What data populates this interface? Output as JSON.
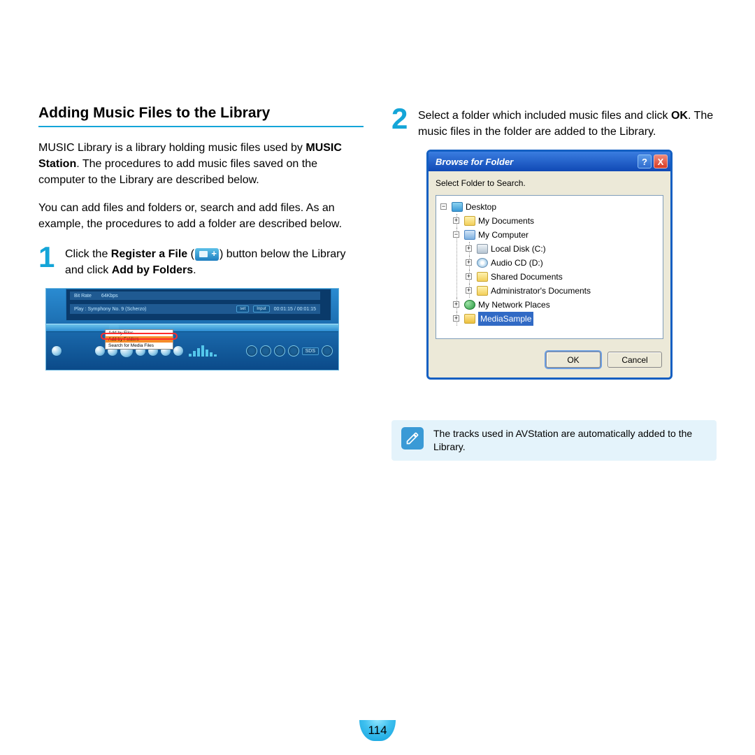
{
  "heading": "Adding Music Files to the Library",
  "intro_parts": {
    "p1_a": "MUSIC Library is a library holding music files used by ",
    "p1_bold": "MUSIC Station",
    "p1_b": ". The procedures to add music files saved on the computer to the Library are described below."
  },
  "intro2": "You can add files and folders or, search and add files. As an example, the procedures to add a folder are described below.",
  "step1": {
    "num": "1",
    "a": "Click the ",
    "b1": "Register a File",
    "mid": " (",
    "mid2": ") button below the Library and click ",
    "b2": "Add by Folders",
    "end": "."
  },
  "shot1": {
    "bitrate_label": "Bit Rate",
    "bitrate_value": "64Kbps",
    "play_label": "Play : Symphony No. 9 (Scherzo)",
    "time": "00:01:15 / 00:01:15",
    "btn_set": "set",
    "btn_input": "Input",
    "dd_items": [
      "Add by Files",
      "Add by Folders",
      "Search for Media Files"
    ],
    "dd_highlight_index": 1
  },
  "step2": {
    "num": "2",
    "a": "Select a folder which included music files and click ",
    "ok": "OK",
    "b": ". The music files in the folder are added to the Library."
  },
  "dialog": {
    "title": "Browse for Folder",
    "instruction": "Select Folder to Search.",
    "tree": {
      "desktop": "Desktop",
      "my_documents": "My Documents",
      "my_computer": "My Computer",
      "local_disk": "Local Disk (C:)",
      "audio_cd": "Audio CD (D:)",
      "shared_docs": "Shared Documents",
      "admin_docs": "Administrator's Documents",
      "network": "My Network Places",
      "selected": "MediaSample"
    },
    "ok": "OK",
    "cancel": "Cancel",
    "help": "?",
    "close": "X"
  },
  "note": "The tracks used in AVStation are automatically added to the Library.",
  "page_number": "114"
}
